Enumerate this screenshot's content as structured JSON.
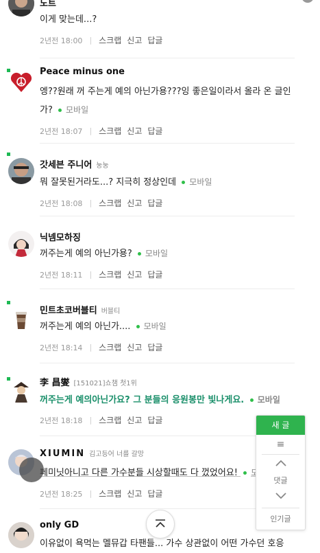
{
  "accent_color": "#2fb34e",
  "comments": [
    {
      "name": "노트",
      "badge": "",
      "text": "이게 맞는데...?",
      "text_tail": "",
      "mobile": "",
      "time": "2년전 18:00"
    },
    {
      "name": "Peace minus one",
      "badge": "",
      "text": "엥??원래 꺼 주는게 예의 아닌가용???잉 좋은일이라서 올라 온 글인",
      "text_tail": "가?",
      "mobile": "모바일",
      "time": "2년전 18:07"
    },
    {
      "name": "갓세븐 주니어",
      "badge": "눙눙",
      "text": "뭐 잘못된거라도...? 지극히 정상인데",
      "text_tail": "",
      "mobile": "모바일",
      "time": "2년전 18:08"
    },
    {
      "name": "닉넴모하징",
      "badge": "",
      "text": "꺼주는게 예의 아닌가용?",
      "text_tail": "",
      "mobile": "모바일",
      "time": "2년전 18:11"
    },
    {
      "name": "민트초코버블티",
      "badge": "버블티",
      "text": "꺼주는게 예의 아닌가....",
      "text_tail": "",
      "mobile": "모바일",
      "time": "2년전 18:14"
    },
    {
      "name": "李 昌燮",
      "badge": "[151021]쇼챔 첫1위",
      "text": "꺼주는게 예의아닌가요? 그 분들의 응원봉만 빛나게요.",
      "text_tail": "",
      "mobile": "모바일",
      "time": "2년전 18:18"
    },
    {
      "name": "XIUMIN",
      "badge": "김고등어 너를 갈망",
      "text": "페미닛아니고 다른 가수분들 시상할때도 다 껐었어요!",
      "text_tail": "",
      "mobile": "모바일",
      "time": "2년전 18:25"
    },
    {
      "name": "only GD",
      "badge": "",
      "text": "이유없이 욕먹는 멜뮤갑 타팬들... 가수 상관없이 어떤 가수던 호응",
      "text_tail": "",
      "mobile": "",
      "time": ""
    }
  ],
  "actions": {
    "scrap": "스크랩",
    "report": "신고",
    "reply": "답글"
  },
  "float_menu": {
    "new_post": "새 글",
    "menu_glyph": "≡",
    "comments": "댓글",
    "popular": "인기글"
  }
}
